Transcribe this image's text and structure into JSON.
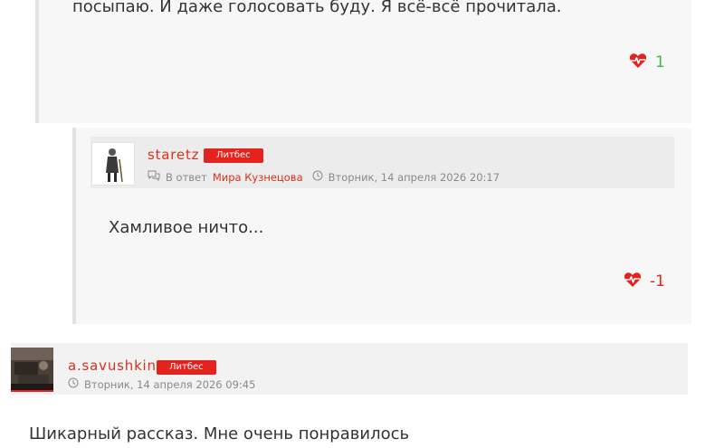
{
  "comments": [
    {
      "text": "посыпаю. И даже голосовать буду. Я всё-всё прочитала.",
      "likes": "1",
      "likes_color": "#4caf50"
    },
    {
      "username": "staretz",
      "badge": "Литбес",
      "reply_prefix": "В ответ",
      "reply_to": "Мира Кузнецова",
      "timestamp": "Вторник, 14 апреля 2026 20:17",
      "text": "Хамливое ничто...",
      "likes": "-1",
      "likes_color": "#e4231f"
    },
    {
      "username": "a.savushkin",
      "badge": "Литбес",
      "timestamp": "Вторник, 14 апреля 2026 09:45",
      "text": "Шикарный рассказ. Мне очень понравилось"
    }
  ],
  "colors": {
    "accent": "#d6321f",
    "badge_bg": "#e4231f",
    "card_bg": "#f7f7f7",
    "header_bg": "#ececec"
  },
  "icons": {
    "like": "heart-pulse-icon",
    "reply": "comments-icon",
    "time": "clock-icon"
  }
}
